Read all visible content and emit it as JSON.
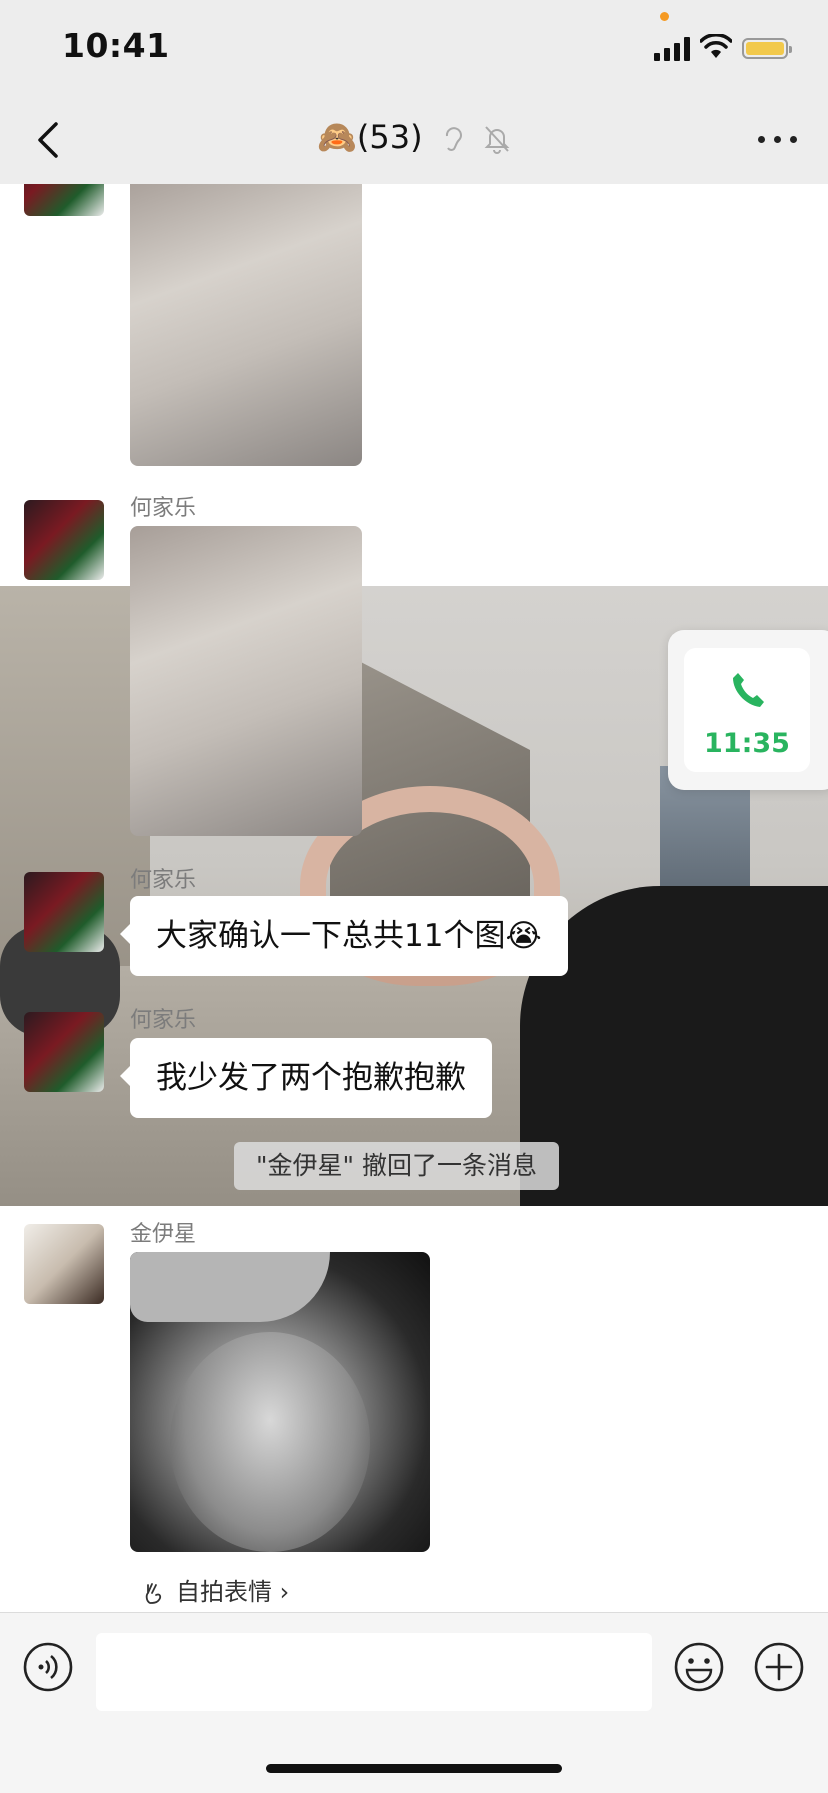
{
  "status_bar": {
    "time": "10:41"
  },
  "nav": {
    "title_emoji": "🙈",
    "title": "(53)"
  },
  "messages": {
    "m2": {
      "sender": "何家乐"
    },
    "m3": {
      "sender": "何家乐",
      "text": "大家确认一下总共11个图",
      "emoji": "😭"
    },
    "m4": {
      "sender": "何家乐",
      "text": "我少发了两个抱歉抱歉"
    },
    "recall_notice": "\"金伊星\" 撤回了一条消息",
    "m5": {
      "sender": "金伊星"
    },
    "selfie_link": "自拍表情 ›"
  },
  "call_float": {
    "time": "11:35"
  },
  "input": {
    "value": ""
  },
  "icons": [
    "back-icon",
    "ear-icon",
    "mute-bell-icon",
    "more-icon",
    "phone-icon",
    "voice-icon",
    "emoji-icon",
    "plus-icon",
    "scissors-hand-icon"
  ],
  "colors": {
    "call_green": "#29b45f",
    "nav_bg": "#ededed"
  }
}
